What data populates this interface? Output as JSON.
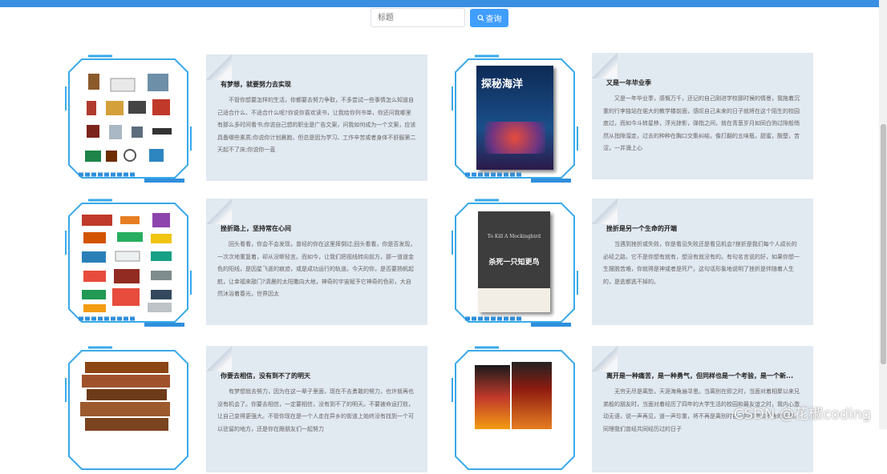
{
  "search": {
    "placeholder": "标题",
    "button_label": "查询"
  },
  "items": [
    {
      "title": "有梦想，就要努力去实现",
      "text": "不管你想要怎样的生活，你都要去努力争取，不多尝试一些事情怎么知道自己适合什么、不适合什么呢?你说你喜欢读书，让我给你列书单，你还问我哪里有那么多时间看书;你说自己想的职业是广告文案，问我如何成为一个文案，应该具备哪些素质;你说你计划晨跑，但总是因为学习、工作辛苦或者身体不舒服第二天起不了床;你说你一直"
    },
    {
      "title": "又是一年毕业季",
      "text": "又是一年毕业季，感慨万千，还记的自己刚进学校那时候的情景，我拖着沉重的行李独站在偌大的教学楼前面，感叹自己未来的日子就将在这个陌生的校园度过，而如今斗转星移，浮光掠影，弹指之间，就在青葱岁月如同白驹过隙般悄然从指隙溜走，过去的种种在胸口交集纠结，像打翻的五味瓶，甜蜜，酸楚，苦涩，一并涌上心"
    },
    {
      "title": "挫折路上，坚持常在心间",
      "text": "回头看看，你会不会发现，曾经的你在这里摔倒过;回头看看，你是否发现，一次次地重复着，却从没断轻言。而如今，让我们把视线转向前方，那一道道金色的阳线，是因星飞逝的痕迹，或是成功运行的轨道。今天的你，是否要扬帆起航，让幸福来敲门?清晨的太阳撒向大地，神奇的宇宙赋予它神奇的色彩，大自然沐浴着春光，世界因太"
    },
    {
      "title": "挫折是另一个生命的开端",
      "text": "当遇到挫折或失败，你是看见失败还是看见机会?挫折是我们每个人成长的必经之路，它不是你想有就有，想没有就没有的。有句名言说的好，如果你想一生摆脱苦难，你就得是神或者是死尸。这句话形象地说明了挫折是伴随着人生的，是逃都逃不掉的。"
    },
    {
      "title": "你要去相信，没有到不了的明天",
      "text": "有梦想就去努力，因为在这一辈子里面，现在不去勇敢的努力，也许就再也没有机会了。你要去相信，一定要相信，没有到不了的明天。不要被命运打败，让自己变得更强大。不管你现在是一个人走在异乡的街道上始终没有找到一个可以驻留的地方，还是你在跟朋友们一起努力"
    },
    {
      "title": "离开是一种痛苦，是一种勇气，但同样也是一个考验，是一个新...",
      "text": "无穷无尽是离愁，天涯海角遍寻思。当离别在即之时，当面对着相聚以来兄弟般的朋友时，当面对着经历了四年的大学生活的校园和最友谊之时，我内心激动无语，说一声再见，道一声珍重，将不再是离别时自己的珍惜和不舍的证明。同理我们曾经共同经历过的日子"
    }
  ],
  "book_covers": [
    {
      "title": "探秘海洋"
    },
    {
      "title": "杀死一只知更鸟",
      "subtitle": "To Kill A Mockingbird"
    }
  ],
  "watermark": "CSDN @花椒coding",
  "colors": {
    "topbar": "#3a8fe0",
    "button": "#409eff",
    "card_bg": "#e1e9f1",
    "frame": "#3aa9e8"
  }
}
